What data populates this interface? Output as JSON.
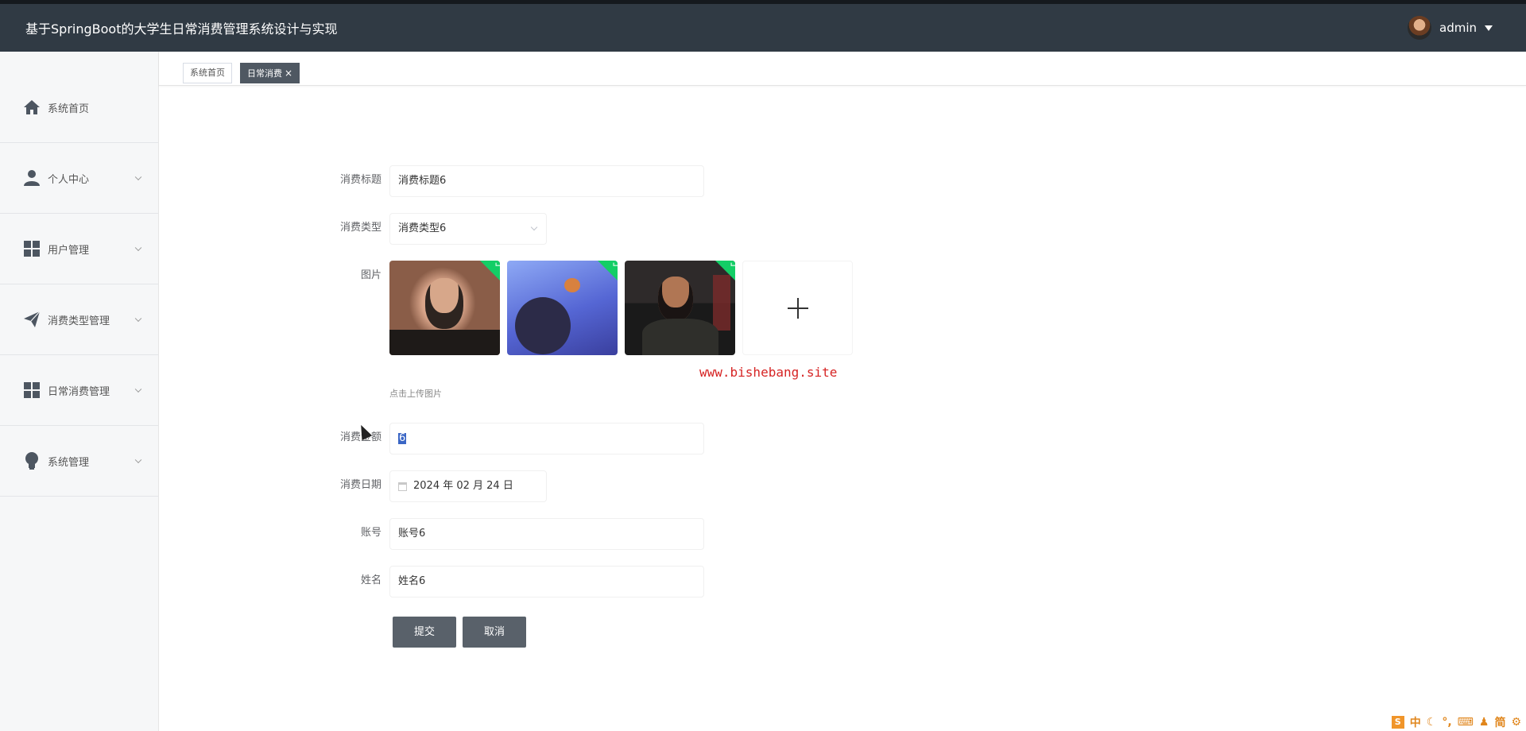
{
  "header": {
    "title": "基于SpringBoot的大学生日常消费管理系统设计与实现",
    "username": "admin"
  },
  "sidebar": {
    "items": [
      {
        "label": "系统首页",
        "icon": "home-icon"
      },
      {
        "label": "个人中心",
        "icon": "user-icon"
      },
      {
        "label": "用户管理",
        "icon": "grid-icon"
      },
      {
        "label": "消费类型管理",
        "icon": "paper-plane-icon"
      },
      {
        "label": "日常消费管理",
        "icon": "grid-icon"
      },
      {
        "label": "系统管理",
        "icon": "lightbulb-icon"
      }
    ]
  },
  "tabs": [
    {
      "label": "系统首页",
      "active": false
    },
    {
      "label": "日常消费",
      "active": true,
      "close": "×"
    }
  ],
  "form": {
    "title_label": "消费标题",
    "title_value": "消费标题6",
    "type_label": "消费类型",
    "type_value": "消费类型6",
    "image_label": "图片",
    "upload_tip": "点击上传图片",
    "amount_label": "消费金额",
    "amount_value": "6",
    "date_label": "消费日期",
    "date_value": "2024 年 02 月 24 日",
    "account_label": "账号",
    "account_value": "账号6",
    "name_label": "姓名",
    "name_value": "姓名6",
    "submit_label": "提交",
    "cancel_label": "取消"
  },
  "watermark": "www.bishebang.site",
  "ime": {
    "lang": "中",
    "mode": "简"
  },
  "colors": {
    "header_bg": "#303a44",
    "button_bg": "#59616a",
    "upload_success": "#13ce66",
    "watermark": "#d62424"
  }
}
